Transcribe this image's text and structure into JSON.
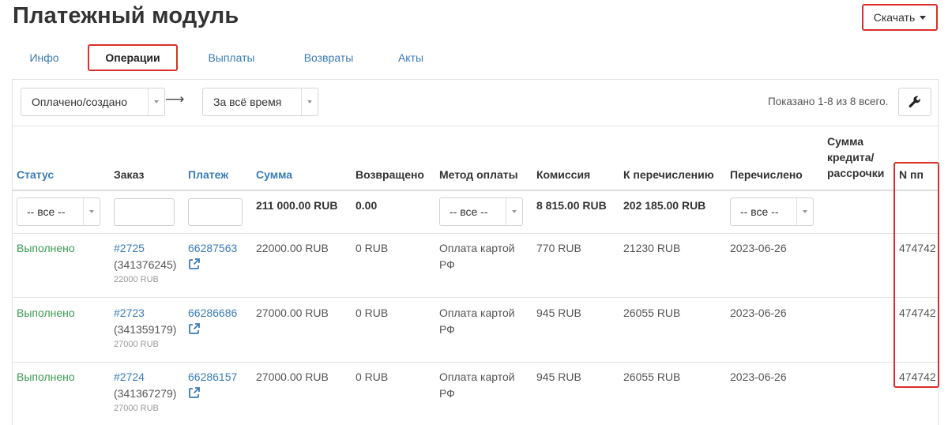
{
  "page": {
    "title": "Платежный модуль",
    "download_label": "Скачать"
  },
  "tabs": [
    {
      "label": "Инфо",
      "active": false
    },
    {
      "label": "Операции",
      "active": true
    },
    {
      "label": "Выплаты",
      "active": false
    },
    {
      "label": "Возвраты",
      "active": false
    },
    {
      "label": "Акты",
      "active": false
    }
  ],
  "filters": {
    "status_mode": "Оплачено/создано",
    "period": "За всё время",
    "shown_text": "Показано 1-8 из 8 всего."
  },
  "columns": {
    "status": "Статус",
    "order": "Заказ",
    "payment": "Платеж",
    "sum": "Сумма",
    "returned": "Возвращено",
    "method": "Метод оплаты",
    "commission": "Комиссия",
    "to_transfer": "К перечислению",
    "transferred": "Перечислено",
    "credit_l1": "Сумма",
    "credit_l2": "кредита/",
    "credit_l3": "рассрочки",
    "npp": "N пп"
  },
  "column_filters": {
    "status": "-- все --",
    "method": "-- все --",
    "transferred": "-- все --"
  },
  "totals": {
    "sum": "211 000.00 RUB",
    "returned": "0.00",
    "commission": "8 815.00 RUB",
    "to_transfer": "202 185.00 RUB"
  },
  "rows": [
    {
      "status": "Выполнено",
      "order_link": "#2725",
      "order_id": "(341376245)",
      "order_sub": "22000 RUB",
      "payment": "66287563",
      "sum": "22000.00 RUB",
      "returned": "0 RUB",
      "method_l1": "Оплата картой",
      "method_l2": "РФ",
      "commission": "770 RUB",
      "to_transfer": "21230 RUB",
      "transferred": "2023-06-26",
      "npp": "474742"
    },
    {
      "status": "Выполнено",
      "order_link": "#2723",
      "order_id": "(341359179)",
      "order_sub": "27000 RUB",
      "payment": "66286686",
      "sum": "27000.00 RUB",
      "returned": "0 RUB",
      "method_l1": "Оплата картой",
      "method_l2": "РФ",
      "commission": "945 RUB",
      "to_transfer": "26055 RUB",
      "transferred": "2023-06-26",
      "npp": "474742"
    },
    {
      "status": "Выполнено",
      "order_link": "#2724",
      "order_id": "(341367279)",
      "order_sub": "27000 RUB",
      "payment": "66286157",
      "sum": "27000.00 RUB",
      "returned": "0 RUB",
      "method_l1": "Оплата картой",
      "method_l2": "РФ",
      "commission": "945 RUB",
      "to_transfer": "26055 RUB",
      "transferred": "2023-06-26",
      "npp": "474742"
    }
  ],
  "colors": {
    "link": "#3a7bb8",
    "status_ok": "#3b9b52",
    "highlight": "#d9302c"
  },
  "icons": {
    "download_caret": "caret-down-icon",
    "settings": "wrench-icon",
    "external": "external-link-icon",
    "arrow": "arrow-right-icon"
  }
}
